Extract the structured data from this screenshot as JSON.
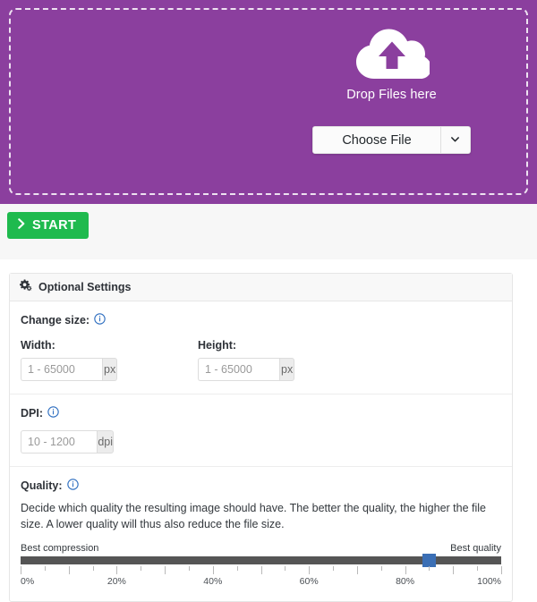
{
  "dropzone": {
    "icon": "cloud-upload-icon",
    "label": "Drop Files here",
    "choose_file_label": "Choose File",
    "caret_icon": "chevron-down-icon",
    "background_color": "#8b3f9e"
  },
  "start": {
    "label": "START",
    "icon": "chevron-right-icon",
    "color": "#1fba4e"
  },
  "settings": {
    "header": {
      "icon": "gears-icon",
      "title": "Optional Settings"
    },
    "change_size": {
      "label": "Change size:",
      "info_icon": "info-circle-icon",
      "width": {
        "label": "Width:",
        "value": "",
        "placeholder": "1 - 65000",
        "unit": "px"
      },
      "height": {
        "label": "Height:",
        "value": "",
        "placeholder": "1 - 65000",
        "unit": "px"
      }
    },
    "dpi": {
      "label": "DPI:",
      "info_icon": "info-circle-icon",
      "value": "",
      "placeholder": "10 - 1200",
      "unit": "dpi"
    },
    "quality": {
      "label": "Quality:",
      "info_icon": "info-circle-icon",
      "description": "Decide which quality the resulting image should have. The better the quality, the higher the file size. A lower quality will thus also reduce the file size.",
      "slider": {
        "min_label": "Best compression",
        "max_label": "Best quality",
        "value": 85,
        "min": 0,
        "max": 100,
        "handle_color": "#3b6fb5",
        "track_color": "#555555",
        "tick_labels": [
          "0%",
          "20%",
          "40%",
          "60%",
          "80%",
          "100%"
        ],
        "tick_step": 5,
        "major_tick_step": 10
      }
    }
  }
}
